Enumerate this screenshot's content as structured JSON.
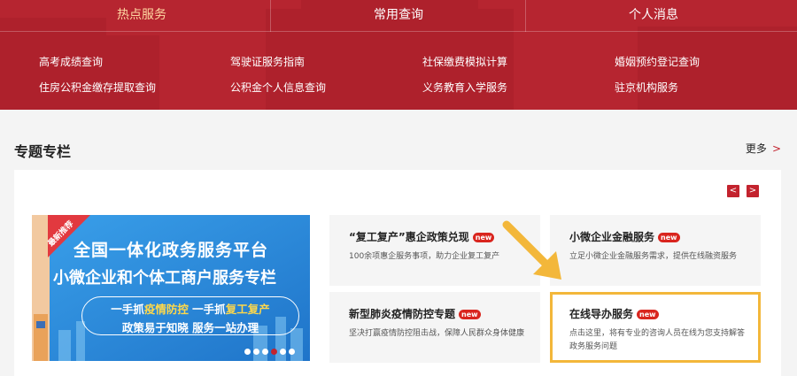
{
  "tabs": [
    {
      "label": "热点服务",
      "active": true
    },
    {
      "label": "常用查询",
      "active": false
    },
    {
      "label": "个人消息",
      "active": false
    }
  ],
  "hot_links": [
    "高考成绩查询",
    "驾驶证服务指南",
    "社保缴费模拟计算",
    "婚姻预约登记查询",
    "住房公积金缴存提取查询",
    "公积金个人信息查询",
    "义务教育入学服务",
    "驻京机构服务"
  ],
  "section": {
    "title": "专题专栏",
    "more": "更多",
    "more_chevron": ">"
  },
  "carousel": {
    "prev": "<",
    "next": ">",
    "active_dot": 3,
    "dot_count": 6
  },
  "banner": {
    "tag": "最新推荐",
    "line1": "全国一体化政务服务平台",
    "line2": "小微企业和个体工商户服务专栏",
    "line3_part1": "一手抓",
    "line3_hl1": "疫情防控",
    "line3_part2": " 一手抓",
    "line3_hl2": "复工复产",
    "line4": "政策易于知晓 服务一站办理"
  },
  "cards": [
    {
      "title": "“复工复产”惠企政策兑现",
      "badge": "new",
      "desc": "100余项惠企服务事项，助力企业复工复产"
    },
    {
      "title": "小微企业金融服务",
      "badge": "new",
      "desc": "立足小微企业金融服务需求，提供在线融资服务"
    },
    {
      "title": "新型肺炎疫情防控专题",
      "badge": "new",
      "desc": "坚决打赢疫情防控阻击战，保障人民群众身体健康"
    },
    {
      "title": "在线导办服务",
      "badge": "new",
      "desc": "点击这里，将有专业的咨询人员在线为您支持解答政务服务问题"
    }
  ],
  "colors": {
    "brand_red": "#b62530",
    "accent_red": "#c3232e",
    "highlight": "#f3b73a",
    "tab_active": "#ffd7a2"
  }
}
